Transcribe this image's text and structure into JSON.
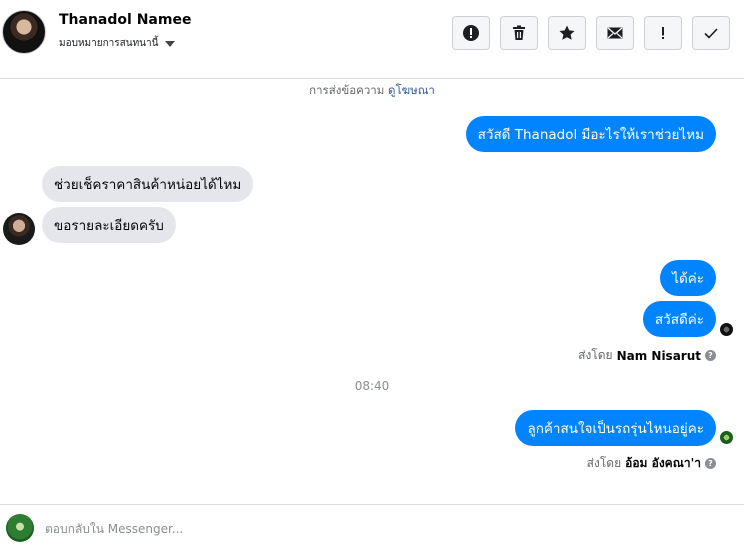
{
  "header": {
    "name": "Thanadol Namee",
    "assign_label": "มอบหมายการสนทนานี้"
  },
  "toolbar": {
    "icons": [
      "alert-circle-icon",
      "trash-icon",
      "star-icon",
      "envelope-icon",
      "exclamation-icon",
      "check-icon"
    ]
  },
  "notice": {
    "text": "การส่งข้อความ",
    "link": "ดูโฆษณา"
  },
  "messages": [
    {
      "side": "out",
      "text": "สวัสดี Thanadol มีอะไรให้เราช่วยไหม"
    },
    {
      "side": "in",
      "text": "ช่วยเช็คราคาสินค้าหน่อยได้ไหม"
    },
    {
      "side": "in",
      "text": "ขอรายละเอียดครับ"
    },
    {
      "side": "out",
      "text": "ได้ค่ะ"
    },
    {
      "side": "out",
      "text": "สวัสดีค่ะ"
    },
    {
      "side": "out",
      "text": "ลูกค้าสนใจเป็นรถรุ่นไหนอยู่คะ"
    }
  ],
  "sent_by": [
    {
      "prefix": "ส่งโดย",
      "name": "Nam Nisarut"
    },
    {
      "prefix": "ส่งโดย",
      "name": "อ้อม อังคณา'า"
    }
  ],
  "timestamp": "08:40",
  "composer": {
    "placeholder": "ตอบกลับใน Messenger..."
  },
  "colors": {
    "outgoing_bubble": "#0084ff",
    "incoming_bubble": "#e4e6eb",
    "link": "#385898"
  }
}
